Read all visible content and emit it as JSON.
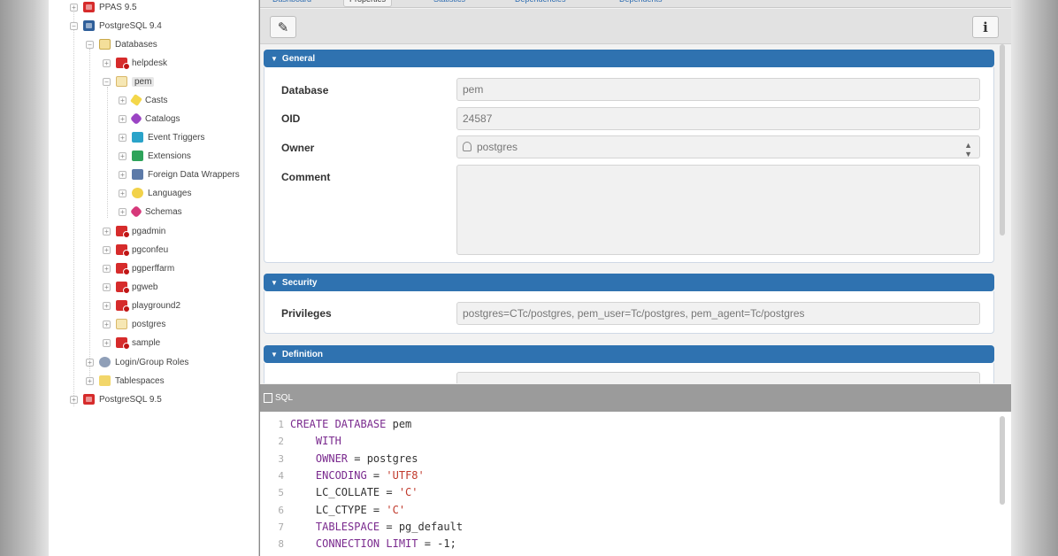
{
  "tree": {
    "items": [
      {
        "label": "PPAS 9.5",
        "icon": "server-icon"
      },
      {
        "label": "PostgreSQL 9.4",
        "icon": "server-icon"
      },
      {
        "label": "Databases",
        "icon": "databases-folder-icon"
      },
      {
        "label": "helpdesk",
        "icon": "database-icon"
      },
      {
        "label": "pem",
        "icon": "database-icon"
      },
      {
        "label": "Casts",
        "icon": "casts-icon"
      },
      {
        "label": "Catalogs",
        "icon": "catalog-icon"
      },
      {
        "label": "Event Triggers",
        "icon": "event-trigger-icon"
      },
      {
        "label": "Extensions",
        "icon": "extension-icon"
      },
      {
        "label": "Foreign Data Wrappers",
        "icon": "foreign-data-wrapper-icon"
      },
      {
        "label": "Languages",
        "icon": "language-icon"
      },
      {
        "label": "Schemas",
        "icon": "schema-icon"
      },
      {
        "label": "pgadmin",
        "icon": "database-icon"
      },
      {
        "label": "pgconfeu",
        "icon": "database-icon"
      },
      {
        "label": "pgperffarm",
        "icon": "database-icon"
      },
      {
        "label": "pgweb",
        "icon": "database-icon"
      },
      {
        "label": "playground2",
        "icon": "database-icon"
      },
      {
        "label": "postgres",
        "icon": "database-icon"
      },
      {
        "label": "sample",
        "icon": "database-icon"
      },
      {
        "label": "Login/Group Roles",
        "icon": "roles-icon"
      },
      {
        "label": "Tablespaces",
        "icon": "tablespaces-icon"
      },
      {
        "label": "PostgreSQL 9.5",
        "icon": "server-icon"
      }
    ]
  },
  "tabs": [
    "Dashboard",
    "Properties",
    "Statistics",
    "Dependencies",
    "Dependents"
  ],
  "toolbar": {
    "edit_icon": "edit-icon",
    "info_icon": "info-icon",
    "info_label": "i",
    "edit_glyph": "✎"
  },
  "sections": {
    "general": {
      "title": "General"
    },
    "security": {
      "title": "Security"
    },
    "definition": {
      "title": "Definition"
    }
  },
  "form": {
    "database_label": "Database",
    "database_value": "pem",
    "oid_label": "OID",
    "oid_value": "24587",
    "owner_label": "Owner",
    "owner_value": "postgres",
    "comment_label": "Comment",
    "comment_value": "",
    "privileges_label": "Privileges",
    "privileges_value": "postgres=CTc/postgres, pem_user=Tc/postgres, pem_agent=Tc/postgres"
  },
  "sql": {
    "title": "SQL",
    "lines": [
      [
        {
          "t": "CREATE DATABASE",
          "c": "kw"
        },
        {
          "t": " pem",
          "c": ""
        }
      ],
      [
        {
          "t": "    WITH",
          "c": "kw"
        }
      ],
      [
        {
          "t": "    OWNER",
          "c": "kw"
        },
        {
          "t": " = postgres",
          "c": ""
        }
      ],
      [
        {
          "t": "    ENCODING",
          "c": "kw"
        },
        {
          "t": " = ",
          "c": ""
        },
        {
          "t": "'UTF8'",
          "c": "str"
        }
      ],
      [
        {
          "t": "    LC_COLLATE = ",
          "c": ""
        },
        {
          "t": "'C'",
          "c": "str"
        }
      ],
      [
        {
          "t": "    LC_CTYPE = ",
          "c": ""
        },
        {
          "t": "'C'",
          "c": "str"
        }
      ],
      [
        {
          "t": "    TABLESPACE",
          "c": "kw"
        },
        {
          "t": " = pg_default",
          "c": ""
        }
      ],
      [
        {
          "t": "    CONNECTION LIMIT",
          "c": "kw"
        },
        {
          "t": " = -1;",
          "c": ""
        }
      ]
    ]
  },
  "colors": {
    "section_header": "#2f72b0",
    "keyword": "#7a2a8e",
    "string": "#c0392b"
  }
}
